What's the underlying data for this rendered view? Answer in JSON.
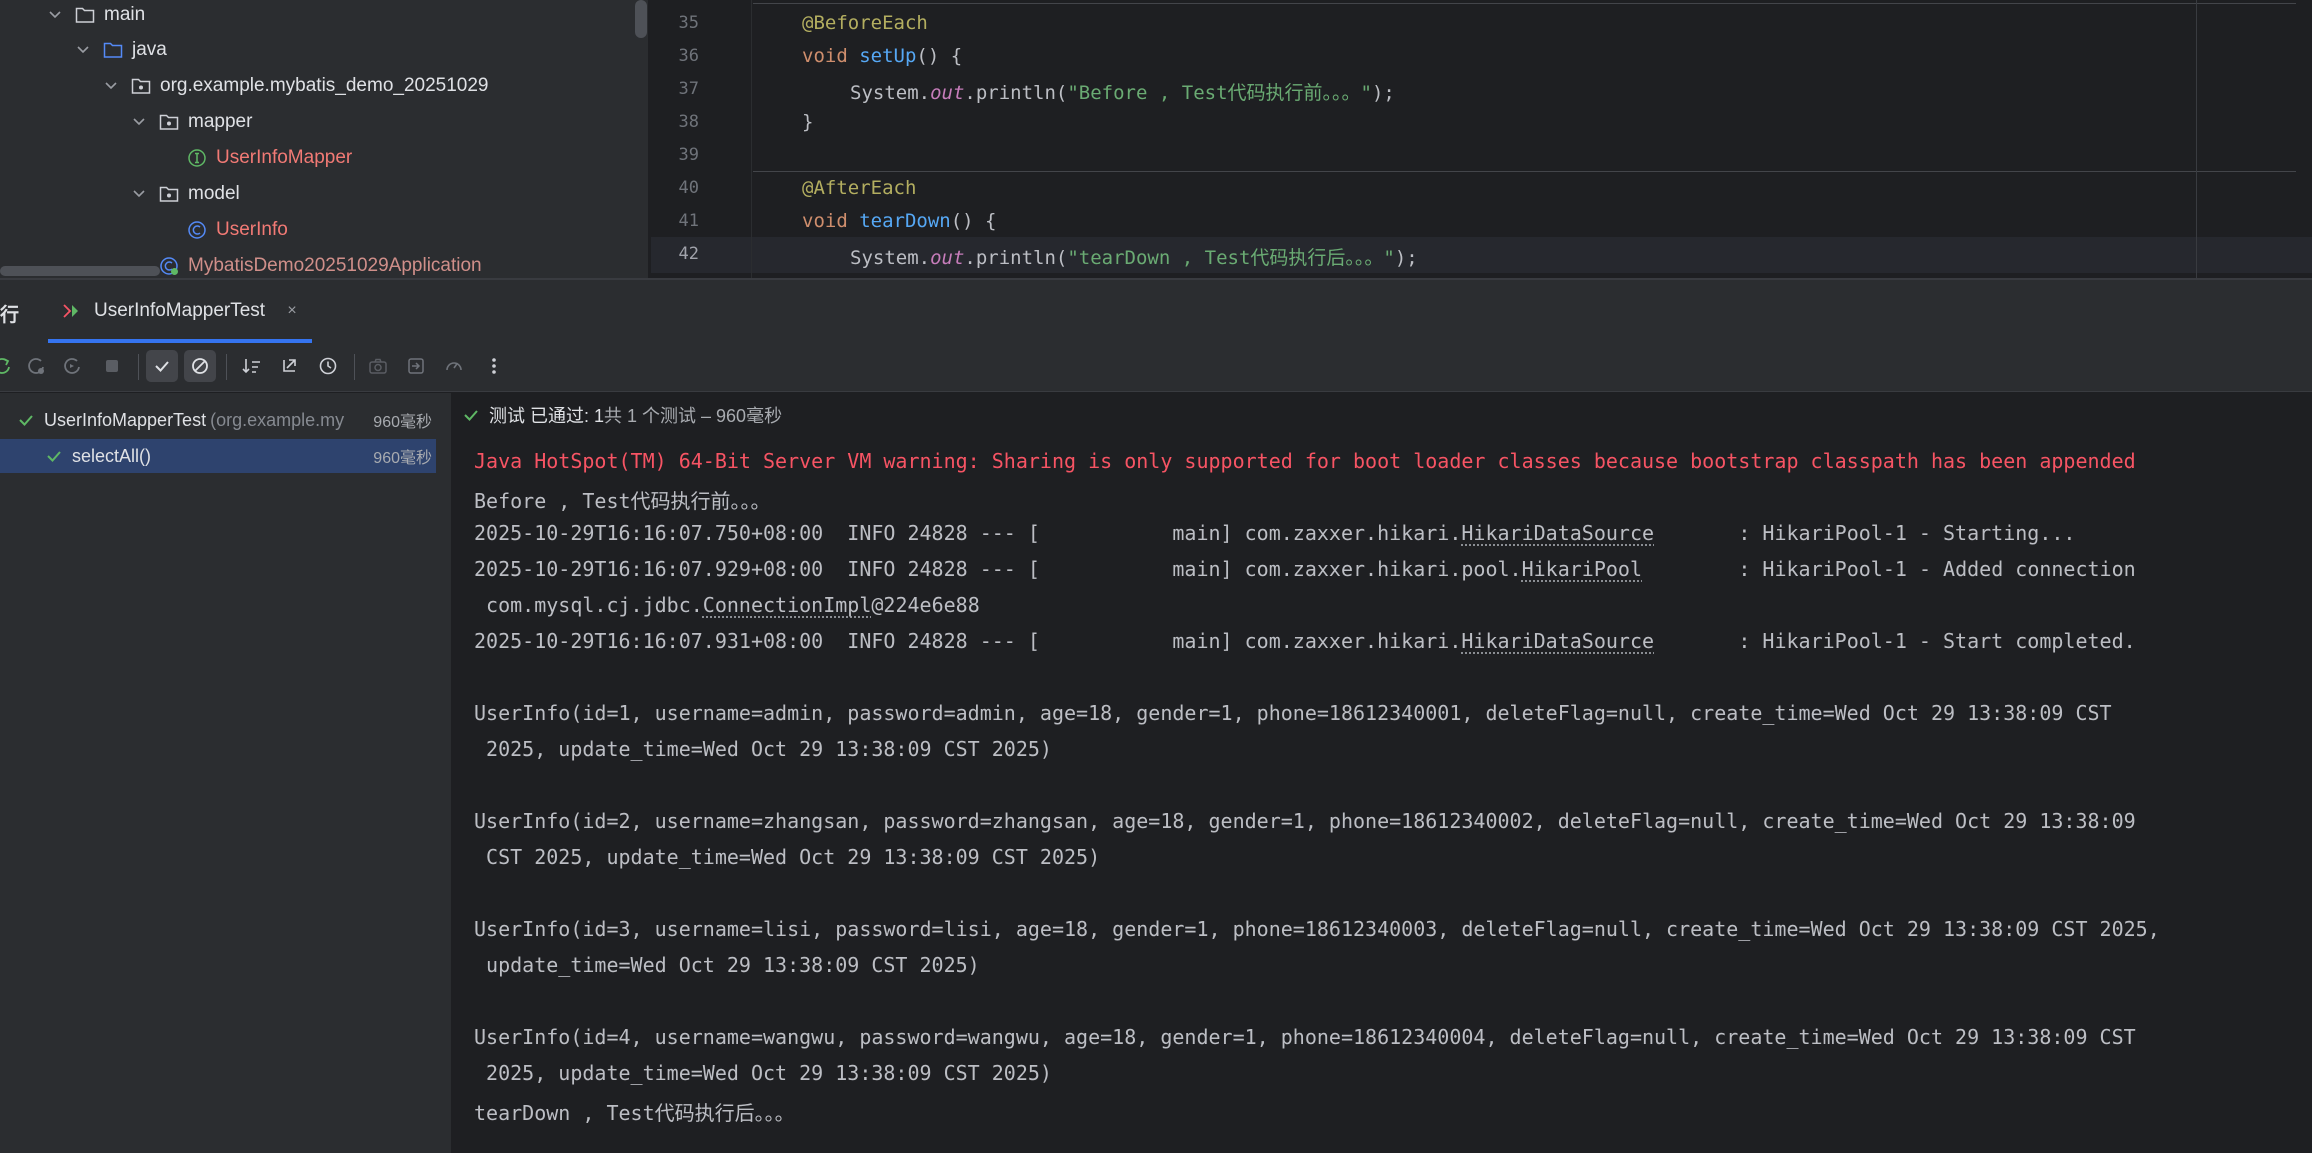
{
  "project_tree": {
    "items": [
      {
        "label": "main",
        "kind": "folder"
      },
      {
        "label": "java",
        "kind": "source-folder"
      },
      {
        "label": "org.example.mybatis_demo_20251029",
        "kind": "package"
      },
      {
        "label": "mapper",
        "kind": "package"
      },
      {
        "label": "UserInfoMapper",
        "kind": "interface"
      },
      {
        "label": "model",
        "kind": "package"
      },
      {
        "label": "UserInfo",
        "kind": "class"
      },
      {
        "label": "MybatisDemo20251029Application",
        "kind": "spring-class"
      }
    ]
  },
  "editor": {
    "line_numbers": [
      "35",
      "36",
      "37",
      "38",
      "39",
      "40",
      "41",
      "42"
    ],
    "lines": {
      "l35": {
        "annotation": "@BeforeEach"
      },
      "l36": {
        "kw": "void",
        "fn": "setUp",
        "rest": "() {"
      },
      "l37": {
        "obj": "System.",
        "field": "out",
        "call": ".println(",
        "str": "\"Before , Test代码执行前。。。\"",
        "end": ");"
      },
      "l38": {
        "text": "}"
      },
      "l40": {
        "annotation": "@AfterEach"
      },
      "l41": {
        "kw": "void",
        "fn": "tearDown",
        "rest": "() {"
      },
      "l42": {
        "obj": "System.",
        "field": "out",
        "call": ".println(",
        "str": "\"tearDown , Test代码执行后。。。\"",
        "end": ");"
      }
    }
  },
  "run_window": {
    "title": "行",
    "tab_label": "UserInfoMapperTest",
    "tab_close": "×"
  },
  "toolbar": {
    "icons": [
      "rerun-icon",
      "rerun-failed-icon",
      "toggle-auto-test-icon",
      "stop-icon",
      "show-passed-icon",
      "show-ignored-icon",
      "sort-alpha-icon",
      "collapse-all-icon",
      "history-icon",
      "screenshot-icon",
      "export-icon",
      "coverage-icon",
      "more-icon"
    ]
  },
  "test_tree": {
    "suite": {
      "name": "UserInfoMapperTest",
      "package": "(org.example.my",
      "time": "960毫秒"
    },
    "tests": [
      {
        "name": "selectAll()",
        "time": "960毫秒"
      }
    ]
  },
  "status": {
    "passed_label": "测试 已通过: 1",
    "summary": "共 1 个测试 – 960毫秒"
  },
  "console": {
    "warning": "Java HotSpot(TM) 64-Bit Server VM warning: Sharing is only supported for boot loader classes because bootstrap classpath has been appended",
    "before": "Before , Test代码执行前。。。",
    "log1": {
      "prefix": "2025-10-29T16:16:07.750+08:00  INFO 24828 --- [           main] com.zaxxer.hikari.",
      "cls": "HikariDataSource",
      "suffix": "       : HikariPool-1 - Starting..."
    },
    "log2": {
      "prefix": "2025-10-29T16:16:07.929+08:00  INFO 24828 --- [           main] com.zaxxer.hikari.pool.",
      "cls": "HikariPool",
      "suffix": "        : HikariPool-1 - Added connection"
    },
    "log2b": {
      "prefix": " com.mysql.cj.jdbc.",
      "cls": "ConnectionImpl",
      "suffix": "@224e6e88"
    },
    "log3": {
      "prefix": "2025-10-29T16:16:07.931+08:00  INFO 24828 --- [           main] com.zaxxer.hikari.",
      "cls": "HikariDataSource",
      "suffix": "       : HikariPool-1 - Start completed."
    },
    "u1a": "UserInfo(id=1, username=admin, password=admin, age=18, gender=1, phone=18612340001, deleteFlag=null, create_time=Wed Oct 29 13:38:09 CST",
    "u1b": " 2025, update_time=Wed Oct 29 13:38:09 CST 2025)",
    "u2a": "UserInfo(id=2, username=zhangsan, password=zhangsan, age=18, gender=1, phone=18612340002, deleteFlag=null, create_time=Wed Oct 29 13:38:09",
    "u2b": " CST 2025, update_time=Wed Oct 29 13:38:09 CST 2025)",
    "u3a": "UserInfo(id=3, username=lisi, password=lisi, age=18, gender=1, phone=18612340003, deleteFlag=null, create_time=Wed Oct 29 13:38:09 CST 2025,",
    "u3b": " update_time=Wed Oct 29 13:38:09 CST 2025)",
    "u4a": "UserInfo(id=4, username=wangwu, password=wangwu, age=18, gender=1, phone=18612340004, deleteFlag=null, create_time=Wed Oct 29 13:38:09 CST",
    "u4b": " 2025, update_time=Wed Oct 29 13:38:09 CST 2025)",
    "teardown": "tearDown , Test代码执行后。。。"
  },
  "colors": {
    "accent": "#3574f0",
    "pass_green": "#5fb865",
    "error_red": "#f75464",
    "selection": "#2e436e"
  }
}
